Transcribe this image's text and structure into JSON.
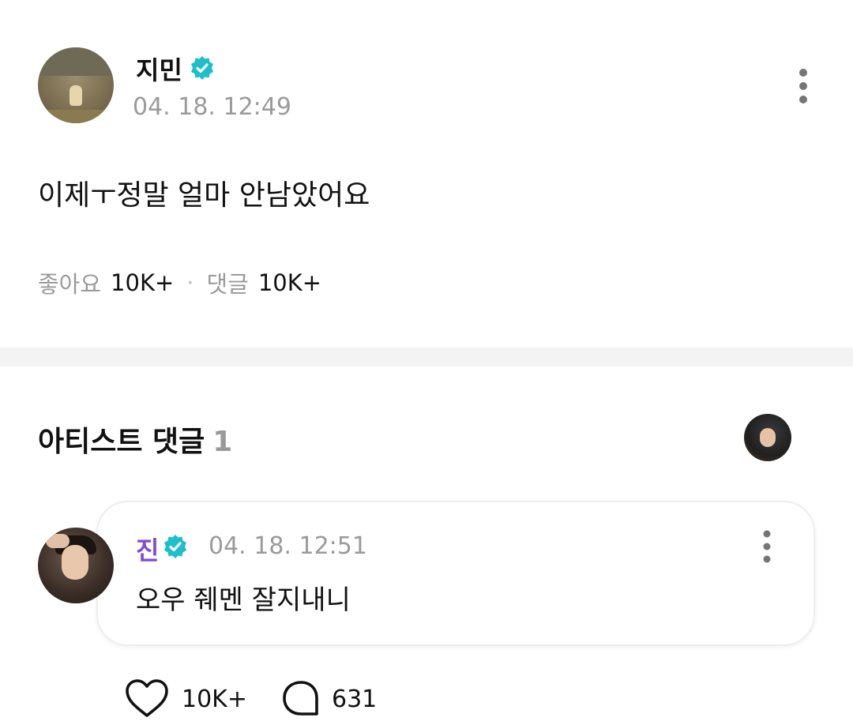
{
  "post": {
    "author": "지민",
    "timestamp": "04. 18. 12:49",
    "body": "이제ㅜ정말 얼마 안남았어요",
    "likes_label": "좋아요",
    "likes_count": "10K+",
    "comments_label": "댓글",
    "comments_count": "10K+"
  },
  "artist_comments": {
    "title": "아티스트 댓글",
    "count": "1"
  },
  "comment": {
    "author": "진",
    "timestamp": "04. 18. 12:51",
    "text": "오우 줴멘 잘지내니",
    "likes": "10K+",
    "replies": "631"
  },
  "colors": {
    "verified": "#1dbfca",
    "artist_name": "#7e4bd6",
    "muted": "#9a9a9a"
  },
  "icons": [
    "verified-badge-icon",
    "more-vertical-icon",
    "heart-icon",
    "comment-bubble-icon"
  ]
}
